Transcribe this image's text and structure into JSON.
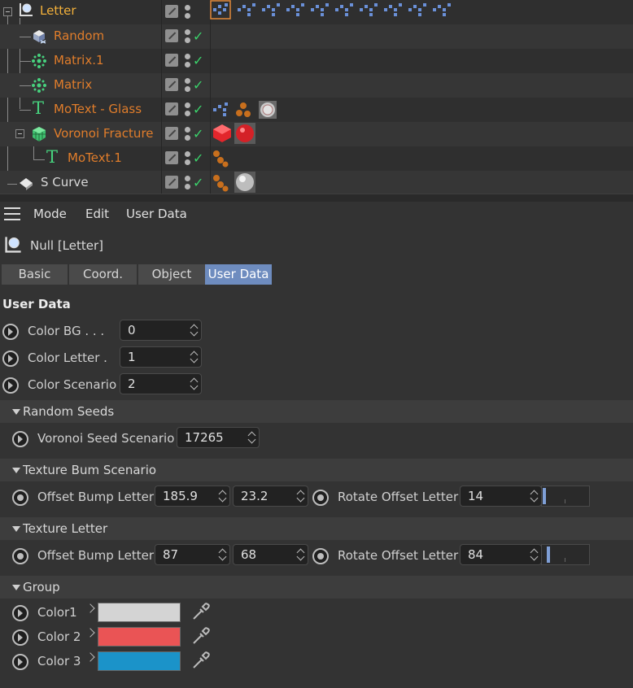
{
  "tree": {
    "rows": [
      {
        "name": "Letter"
      },
      {
        "name": "Random"
      },
      {
        "name": "Matrix.1"
      },
      {
        "name": "Matrix"
      },
      {
        "name": "MoText - Glass"
      },
      {
        "name": "Voronoi Fracture"
      },
      {
        "name": "MoText.1"
      },
      {
        "name": "S Curve"
      }
    ]
  },
  "menu": {
    "mode": "Mode",
    "edit": "Edit",
    "user_data": "User Data"
  },
  "object_header": {
    "title": "Null [Letter]"
  },
  "tabs": [
    "Basic",
    "Coord.",
    "Object",
    "User Data"
  ],
  "active_tab": "User Data",
  "section_title": "User Data",
  "user_data": [
    {
      "label": "Color BG . . .",
      "value": "0"
    },
    {
      "label": "Color Letter .",
      "value": "1"
    },
    {
      "label": "Color Scenario",
      "value": "2"
    }
  ],
  "groups": {
    "random_seeds": {
      "title": "Random Seeds",
      "label": "Voronoi Seed Scenario",
      "value": "17265"
    },
    "texture_bum": {
      "title": "Texture Bum Scenario",
      "label": "Offset Bump Letter",
      "x": "185.9",
      "y": "23.2",
      "rotate_label": "Rotate Offset Letter",
      "rotate_value": "14",
      "rotate_level": 0.02
    },
    "texture_letter": {
      "title": "Texture Letter",
      "label": "Offset Bump Letter",
      "x": "87",
      "y": "68",
      "rotate_label": "Rotate Offset Letter",
      "rotate_value": "84",
      "rotate_level": 0.12
    },
    "group": {
      "title": "Group",
      "colors": [
        {
          "label": "Color1",
          "hex": "#d4d4d4"
        },
        {
          "label": "Color 2",
          "hex": "#ea5455"
        },
        {
          "label": "Color 3",
          "hex": "#1b93c9"
        }
      ]
    }
  },
  "colors": {
    "accent": "#6e8cbf",
    "object_name": "#e07d2b",
    "check": "#3bd36b"
  }
}
